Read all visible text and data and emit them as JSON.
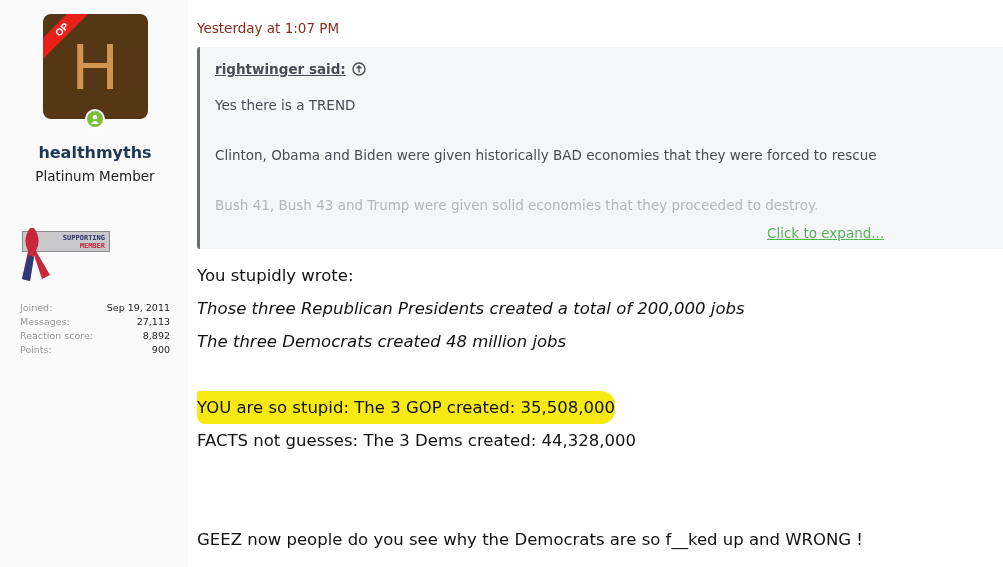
{
  "user": {
    "avatar_letter": "H",
    "op_badge": "OP",
    "online": true,
    "name": "healthmyths",
    "title": "Platinum Member",
    "banner": [
      "SUPPORTING",
      "MEMBER"
    ],
    "stats": [
      {
        "label": "Joined:",
        "value": "Sep 19, 2011"
      },
      {
        "label": "Messages:",
        "value": "27,113"
      },
      {
        "label": "Reaction score:",
        "value": "8,892"
      },
      {
        "label": "Points:",
        "value": "900"
      }
    ]
  },
  "post": {
    "timestamp": "Yesterday at 1:07 PM",
    "quote": {
      "author": "rightwinger said:",
      "paragraphs": [
        "Yes there is a TREND",
        "Clinton, Obama and Biden were given historically BAD economies that they were forced to rescue",
        "Bush 41, Bush 43 and Trump were given solid economies that they proceeded to destroy."
      ],
      "expand": "Click to expand..."
    },
    "lines": [
      {
        "text": "You stupidly wrote:",
        "kind": "plain",
        "highlighted": false
      },
      {
        "text": "Those three Republican Presidents created a total of 200,000 jobs",
        "kind": "italic",
        "highlighted": false
      },
      {
        "text": "The three Democrats created 48 million jobs",
        "kind": "italic",
        "highlighted": false
      },
      {
        "kind": "gap"
      },
      {
        "text": "YOU are so stupid: The 3 GOP created: 35,508,000",
        "kind": "plain",
        "highlighted": true
      },
      {
        "text": "FACTS not guesses: The 3 Dems created: 44,328,000",
        "kind": "plain",
        "highlighted": false
      },
      {
        "kind": "gap"
      },
      {
        "kind": "gap"
      },
      {
        "text": "GEEZ now people do you see why the Democrats are so f__ked up and WRONG !",
        "kind": "plain",
        "highlighted": false
      }
    ]
  }
}
